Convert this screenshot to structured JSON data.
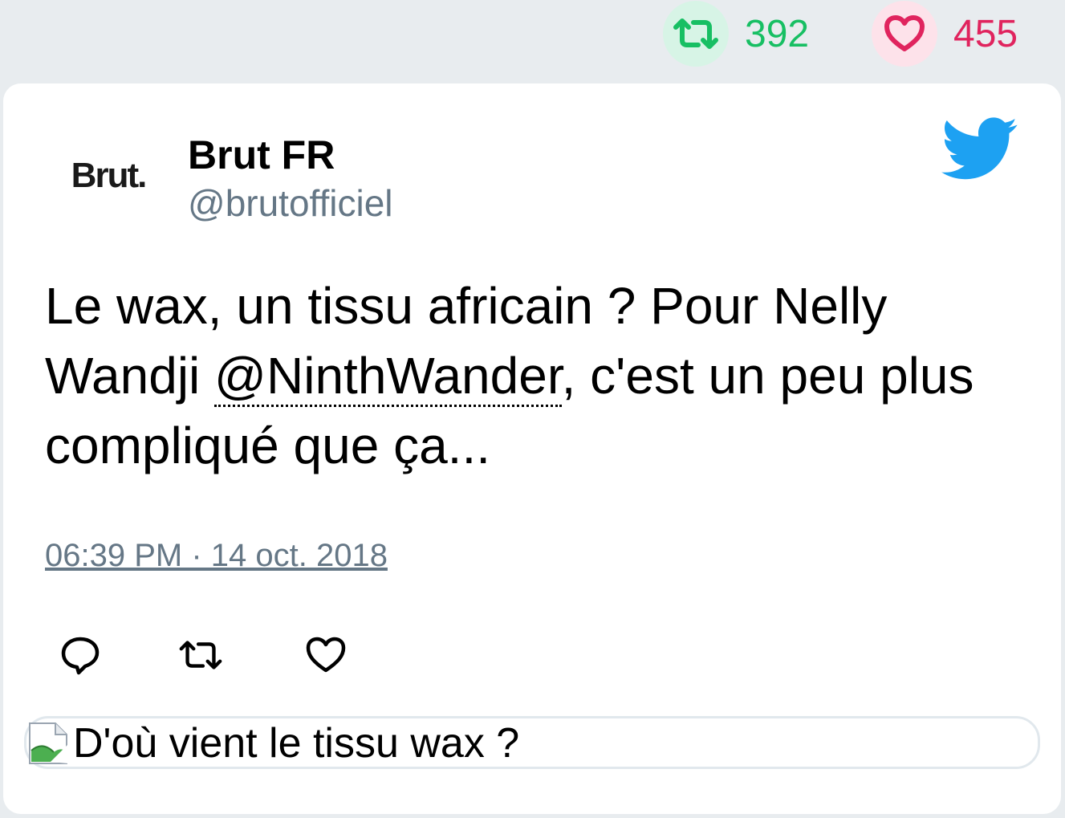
{
  "stats": {
    "retweets": "392",
    "likes": "455",
    "retweet_icon": "retweet-icon",
    "like_icon": "heart-icon"
  },
  "tweet": {
    "avatar_text": "Brut.",
    "author_name": "Brut FR",
    "author_handle": "@brutofficiel",
    "text_before": "Le wax, un tissu africain ? Pour Nelly Wandji ",
    "mention": "@NinthWander",
    "text_after": ", c'est un peu plus compliqué que ça...",
    "timestamp": "06:39 PM · 14 oct. 2018",
    "actions": [
      "reply-icon",
      "retweet-icon",
      "heart-icon"
    ],
    "media_alt": "D'où vient le tissu wax ?"
  },
  "colors": {
    "retweet": "#17bf63",
    "like": "#e0245e",
    "twitter_blue": "#1da1f2",
    "muted": "#657786"
  }
}
